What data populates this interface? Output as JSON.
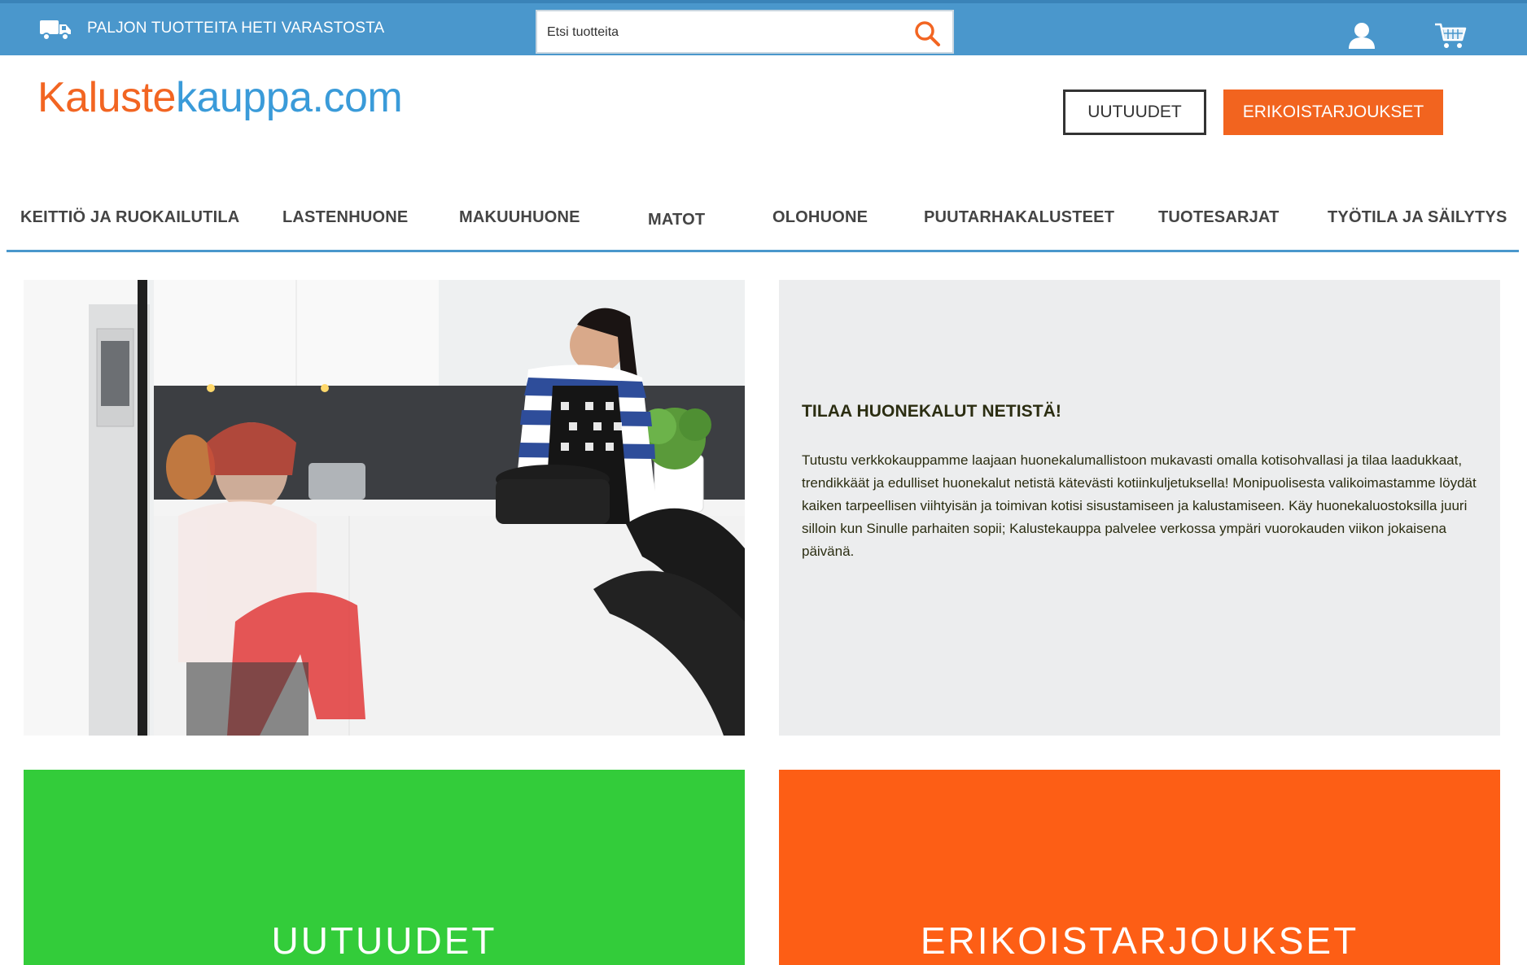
{
  "topbar": {
    "promo_text": "PALJON TUOTTEITA HETI VARASTOSTA",
    "truck_icon": "truck-icon",
    "search_placeholder": "Etsi tuotteita",
    "search_icon": "search-icon",
    "user_icon": "user-icon",
    "cart_icon": "cart-icon",
    "bar_color": "#4a97cc",
    "search_icon_color": "#f26522"
  },
  "header": {
    "logo_part1": "Kaluste",
    "logo_part2": "kauppa.com",
    "logo_color_1": "#f26522",
    "logo_color_2": "#3a9bd9",
    "btn_new_label": "UUTUUDET",
    "btn_offers_label": "ERIKOISTARJOUKSET",
    "offers_color": "#f2641f"
  },
  "nav": {
    "items": [
      "KEITTIÖ JA RUOKAILUTILA",
      "LASTENHUONE",
      "MAKUUHUONE",
      "MATOT",
      "OLOHUONE",
      "PUUTARHAKALUSTEET",
      "TUOTESARJAT",
      "TYÖTILA JA SÄILYTYS"
    ]
  },
  "hero": {
    "title": "TILAA HUONEKALUT NETISTÄ!",
    "body": "Tutustu verkkokauppamme laajaan huonekalumallistoon mukavasti omalla kotisohvallasi ja tilaa laadukkaat, trendikkäät ja edulliset huonekalut netistä kätevästi kotiinkuljetuksella! Monipuolisesta valikoimastamme löydät kaiken tarpeellisen viihtyisän ja toimivan kotisi sisustamiseen ja kalustamiseen. Käy huonekaluostoksilla juuri silloin kun Sinulle parhaiten sopii; Kalustekauppa palvelee verkossa ympäri vuorokauden viikon jokaisena päivänä."
  },
  "tiles": {
    "new_label": "UUTUUDET",
    "offers_label": "ERIKOISTARJOUKSET",
    "new_color": "#33cc3a",
    "offers_color": "#fd5e15"
  }
}
